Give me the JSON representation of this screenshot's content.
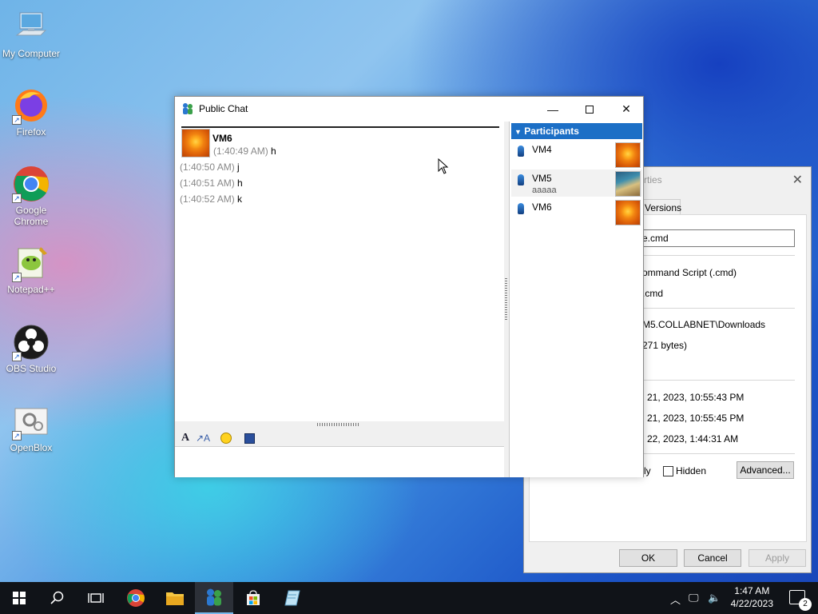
{
  "desktop": {
    "icons": [
      {
        "label": "My Computer"
      },
      {
        "label": "Firefox"
      },
      {
        "label": "Google Chrome"
      },
      {
        "label": "Notepad++"
      },
      {
        "label": "OBS Studio"
      },
      {
        "label": "OpenBlox"
      }
    ]
  },
  "properties_window": {
    "title_fragment": "rties",
    "tab_label": "Versions",
    "filename_value": "e.cmd",
    "rows": [
      "ommand Script (.cmd)",
      ".cmd",
      "M5.COLLABNET\\Downloads",
      "271 bytes)",
      "l 21, 2023, 10:55:43 PM",
      "l 21, 2023, 10:55:45 PM",
      "l 22, 2023, 1:44:31 AM"
    ],
    "readonly_fragment": "ly",
    "hidden_label": "Hidden",
    "advanced_label": "Advanced...",
    "ok_label": "OK",
    "cancel_label": "Cancel",
    "apply_label": "Apply"
  },
  "chat_window": {
    "title": "Public Chat",
    "messages": {
      "sender": "VM6",
      "lines": [
        {
          "ts": "(1:40:49 AM)",
          "text": "h"
        },
        {
          "ts": "(1:40:50 AM)",
          "text": "j"
        },
        {
          "ts": "(1:40:51 AM)",
          "text": "h"
        },
        {
          "ts": "(1:40:52 AM)",
          "text": "k"
        }
      ]
    },
    "input_value": "",
    "participants": {
      "header": "Participants",
      "items": [
        {
          "name": "VM4",
          "status": ""
        },
        {
          "name": "VM5",
          "status": "aaaaa"
        },
        {
          "name": "VM6",
          "status": ""
        }
      ]
    }
  },
  "taskbar": {
    "time": "1:47 AM",
    "date": "4/22/2023",
    "notification_count": "2"
  }
}
